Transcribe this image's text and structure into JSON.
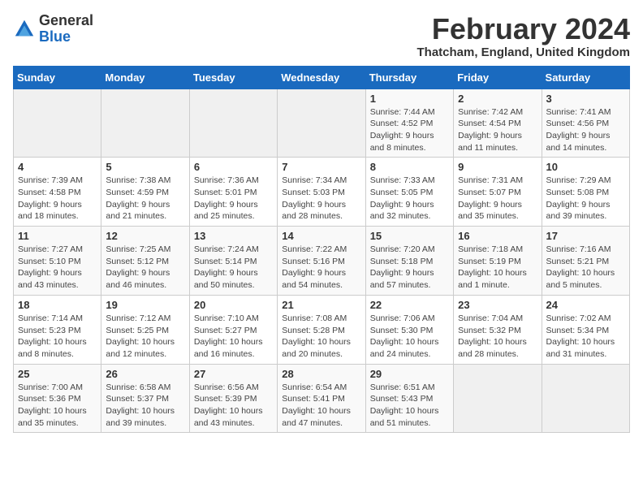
{
  "logo": {
    "text_general": "General",
    "text_blue": "Blue"
  },
  "header": {
    "month_title": "February 2024",
    "location": "Thatcham, England, United Kingdom"
  },
  "days_of_week": [
    "Sunday",
    "Monday",
    "Tuesday",
    "Wednesday",
    "Thursday",
    "Friday",
    "Saturday"
  ],
  "weeks": [
    [
      {
        "day": "",
        "info": ""
      },
      {
        "day": "",
        "info": ""
      },
      {
        "day": "",
        "info": ""
      },
      {
        "day": "",
        "info": ""
      },
      {
        "day": "1",
        "info": "Sunrise: 7:44 AM\nSunset: 4:52 PM\nDaylight: 9 hours\nand 8 minutes."
      },
      {
        "day": "2",
        "info": "Sunrise: 7:42 AM\nSunset: 4:54 PM\nDaylight: 9 hours\nand 11 minutes."
      },
      {
        "day": "3",
        "info": "Sunrise: 7:41 AM\nSunset: 4:56 PM\nDaylight: 9 hours\nand 14 minutes."
      }
    ],
    [
      {
        "day": "4",
        "info": "Sunrise: 7:39 AM\nSunset: 4:58 PM\nDaylight: 9 hours\nand 18 minutes."
      },
      {
        "day": "5",
        "info": "Sunrise: 7:38 AM\nSunset: 4:59 PM\nDaylight: 9 hours\nand 21 minutes."
      },
      {
        "day": "6",
        "info": "Sunrise: 7:36 AM\nSunset: 5:01 PM\nDaylight: 9 hours\nand 25 minutes."
      },
      {
        "day": "7",
        "info": "Sunrise: 7:34 AM\nSunset: 5:03 PM\nDaylight: 9 hours\nand 28 minutes."
      },
      {
        "day": "8",
        "info": "Sunrise: 7:33 AM\nSunset: 5:05 PM\nDaylight: 9 hours\nand 32 minutes."
      },
      {
        "day": "9",
        "info": "Sunrise: 7:31 AM\nSunset: 5:07 PM\nDaylight: 9 hours\nand 35 minutes."
      },
      {
        "day": "10",
        "info": "Sunrise: 7:29 AM\nSunset: 5:08 PM\nDaylight: 9 hours\nand 39 minutes."
      }
    ],
    [
      {
        "day": "11",
        "info": "Sunrise: 7:27 AM\nSunset: 5:10 PM\nDaylight: 9 hours\nand 43 minutes."
      },
      {
        "day": "12",
        "info": "Sunrise: 7:25 AM\nSunset: 5:12 PM\nDaylight: 9 hours\nand 46 minutes."
      },
      {
        "day": "13",
        "info": "Sunrise: 7:24 AM\nSunset: 5:14 PM\nDaylight: 9 hours\nand 50 minutes."
      },
      {
        "day": "14",
        "info": "Sunrise: 7:22 AM\nSunset: 5:16 PM\nDaylight: 9 hours\nand 54 minutes."
      },
      {
        "day": "15",
        "info": "Sunrise: 7:20 AM\nSunset: 5:18 PM\nDaylight: 9 hours\nand 57 minutes."
      },
      {
        "day": "16",
        "info": "Sunrise: 7:18 AM\nSunset: 5:19 PM\nDaylight: 10 hours\nand 1 minute."
      },
      {
        "day": "17",
        "info": "Sunrise: 7:16 AM\nSunset: 5:21 PM\nDaylight: 10 hours\nand 5 minutes."
      }
    ],
    [
      {
        "day": "18",
        "info": "Sunrise: 7:14 AM\nSunset: 5:23 PM\nDaylight: 10 hours\nand 8 minutes."
      },
      {
        "day": "19",
        "info": "Sunrise: 7:12 AM\nSunset: 5:25 PM\nDaylight: 10 hours\nand 12 minutes."
      },
      {
        "day": "20",
        "info": "Sunrise: 7:10 AM\nSunset: 5:27 PM\nDaylight: 10 hours\nand 16 minutes."
      },
      {
        "day": "21",
        "info": "Sunrise: 7:08 AM\nSunset: 5:28 PM\nDaylight: 10 hours\nand 20 minutes."
      },
      {
        "day": "22",
        "info": "Sunrise: 7:06 AM\nSunset: 5:30 PM\nDaylight: 10 hours\nand 24 minutes."
      },
      {
        "day": "23",
        "info": "Sunrise: 7:04 AM\nSunset: 5:32 PM\nDaylight: 10 hours\nand 28 minutes."
      },
      {
        "day": "24",
        "info": "Sunrise: 7:02 AM\nSunset: 5:34 PM\nDaylight: 10 hours\nand 31 minutes."
      }
    ],
    [
      {
        "day": "25",
        "info": "Sunrise: 7:00 AM\nSunset: 5:36 PM\nDaylight: 10 hours\nand 35 minutes."
      },
      {
        "day": "26",
        "info": "Sunrise: 6:58 AM\nSunset: 5:37 PM\nDaylight: 10 hours\nand 39 minutes."
      },
      {
        "day": "27",
        "info": "Sunrise: 6:56 AM\nSunset: 5:39 PM\nDaylight: 10 hours\nand 43 minutes."
      },
      {
        "day": "28",
        "info": "Sunrise: 6:54 AM\nSunset: 5:41 PM\nDaylight: 10 hours\nand 47 minutes."
      },
      {
        "day": "29",
        "info": "Sunrise: 6:51 AM\nSunset: 5:43 PM\nDaylight: 10 hours\nand 51 minutes."
      },
      {
        "day": "",
        "info": ""
      },
      {
        "day": "",
        "info": ""
      }
    ]
  ]
}
